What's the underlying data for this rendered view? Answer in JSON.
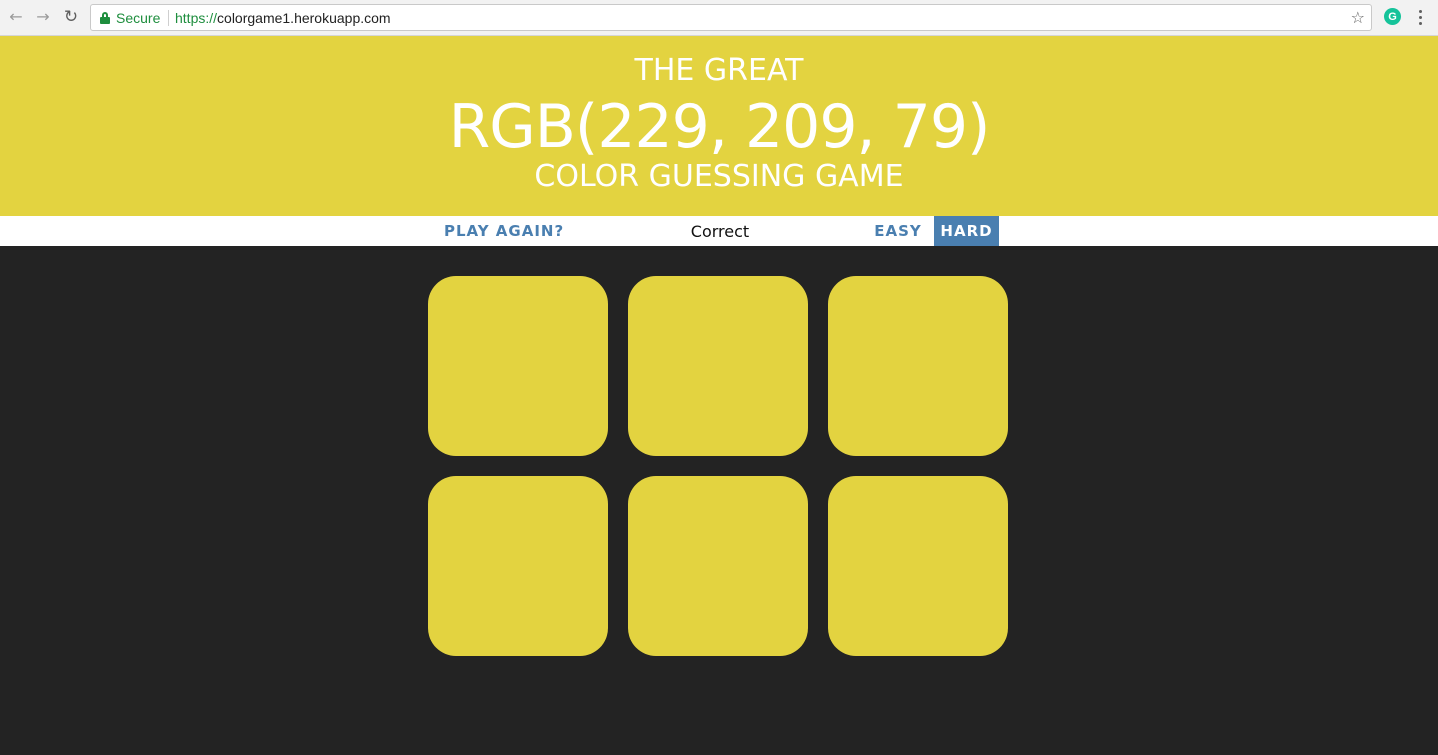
{
  "browser": {
    "secure_label": "Secure",
    "url_scheme": "https://",
    "url_host": "colorgame1.herokuapp.com",
    "extension_letter": "G"
  },
  "header": {
    "line1": "THE GREAT",
    "rgb": "RGB(229, 209, 79)",
    "line3": "COLOR GUESSING GAME",
    "color": "#e3d340"
  },
  "stripe": {
    "play_again": "PLAY AGAIN?",
    "message": "Correct",
    "modes": [
      "EASY",
      "HARD"
    ],
    "active_mode": "HARD",
    "accent": "#4a7fb0"
  },
  "board": {
    "background": "#232323",
    "square_colors": [
      "#e3d340",
      "#e3d340",
      "#e3d340",
      "#e3d340",
      "#e3d340",
      "#e3d340"
    ]
  }
}
